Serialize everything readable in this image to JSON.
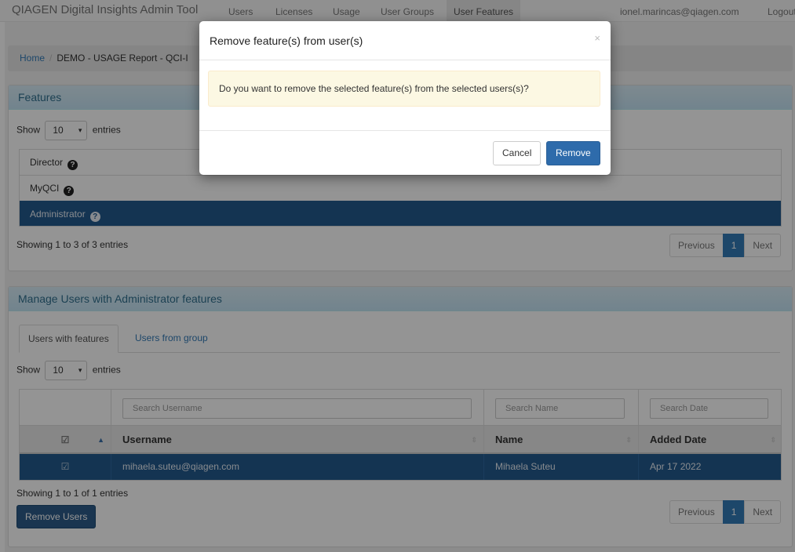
{
  "navbar": {
    "brand": "QIAGEN Digital Insights Admin Tool",
    "items": [
      "Users",
      "Licenses",
      "Usage",
      "User Groups",
      "User Features"
    ],
    "user_email": "ionel.marincas@qiagen.com",
    "logout": "Logout"
  },
  "breadcrumb": {
    "home": "Home",
    "separator": "/",
    "current": "DEMO - USAGE Report - QCI-I"
  },
  "features_panel": {
    "title": "Features",
    "show_label": "Show",
    "entries_value": "10",
    "entries_label": "entries",
    "rows": [
      {
        "label": "Director",
        "selected": false
      },
      {
        "label": "MyQCI",
        "selected": false
      },
      {
        "label": "Administrator",
        "selected": true
      }
    ],
    "info": "Showing 1 to 3 of 3 entries",
    "pager": {
      "previous": "Previous",
      "page": "1",
      "next": "Next"
    }
  },
  "manage_panel": {
    "title": "Manage Users with Administrator features",
    "tabs": [
      "Users with features",
      "Users from group"
    ],
    "show_label": "Show",
    "entries_value": "10",
    "entries_label": "entries",
    "search": {
      "username_placeholder": "Search Username",
      "name_placeholder": "Search Name",
      "date_placeholder": "Search Date"
    },
    "columns": {
      "username": "Username",
      "name": "Name",
      "added_date": "Added Date"
    },
    "rows": [
      {
        "username": "mihaela.suteu@qiagen.com",
        "name": "Mihaela Suteu",
        "added_date": "Apr 17 2022",
        "checked": true
      }
    ],
    "info": "Showing 1 to 1 of 1 entries",
    "remove_users": "Remove Users",
    "pager": {
      "previous": "Previous",
      "page": "1",
      "next": "Next"
    }
  },
  "modal": {
    "title": "Remove feature(s) from user(s)",
    "close_symbol": "×",
    "message": "Do you want to remove the selected feature(s) from the selected users(s)?",
    "cancel": "Cancel",
    "remove": "Remove"
  },
  "glyphs": {
    "question": "?",
    "chevron": "▾",
    "check": "☑",
    "sort_asc": "▲",
    "sort": "⇕"
  },
  "colors": {
    "selected_row": "#245a8d",
    "primary": "#337ab7",
    "alert_bg": "#fcf8e3"
  }
}
